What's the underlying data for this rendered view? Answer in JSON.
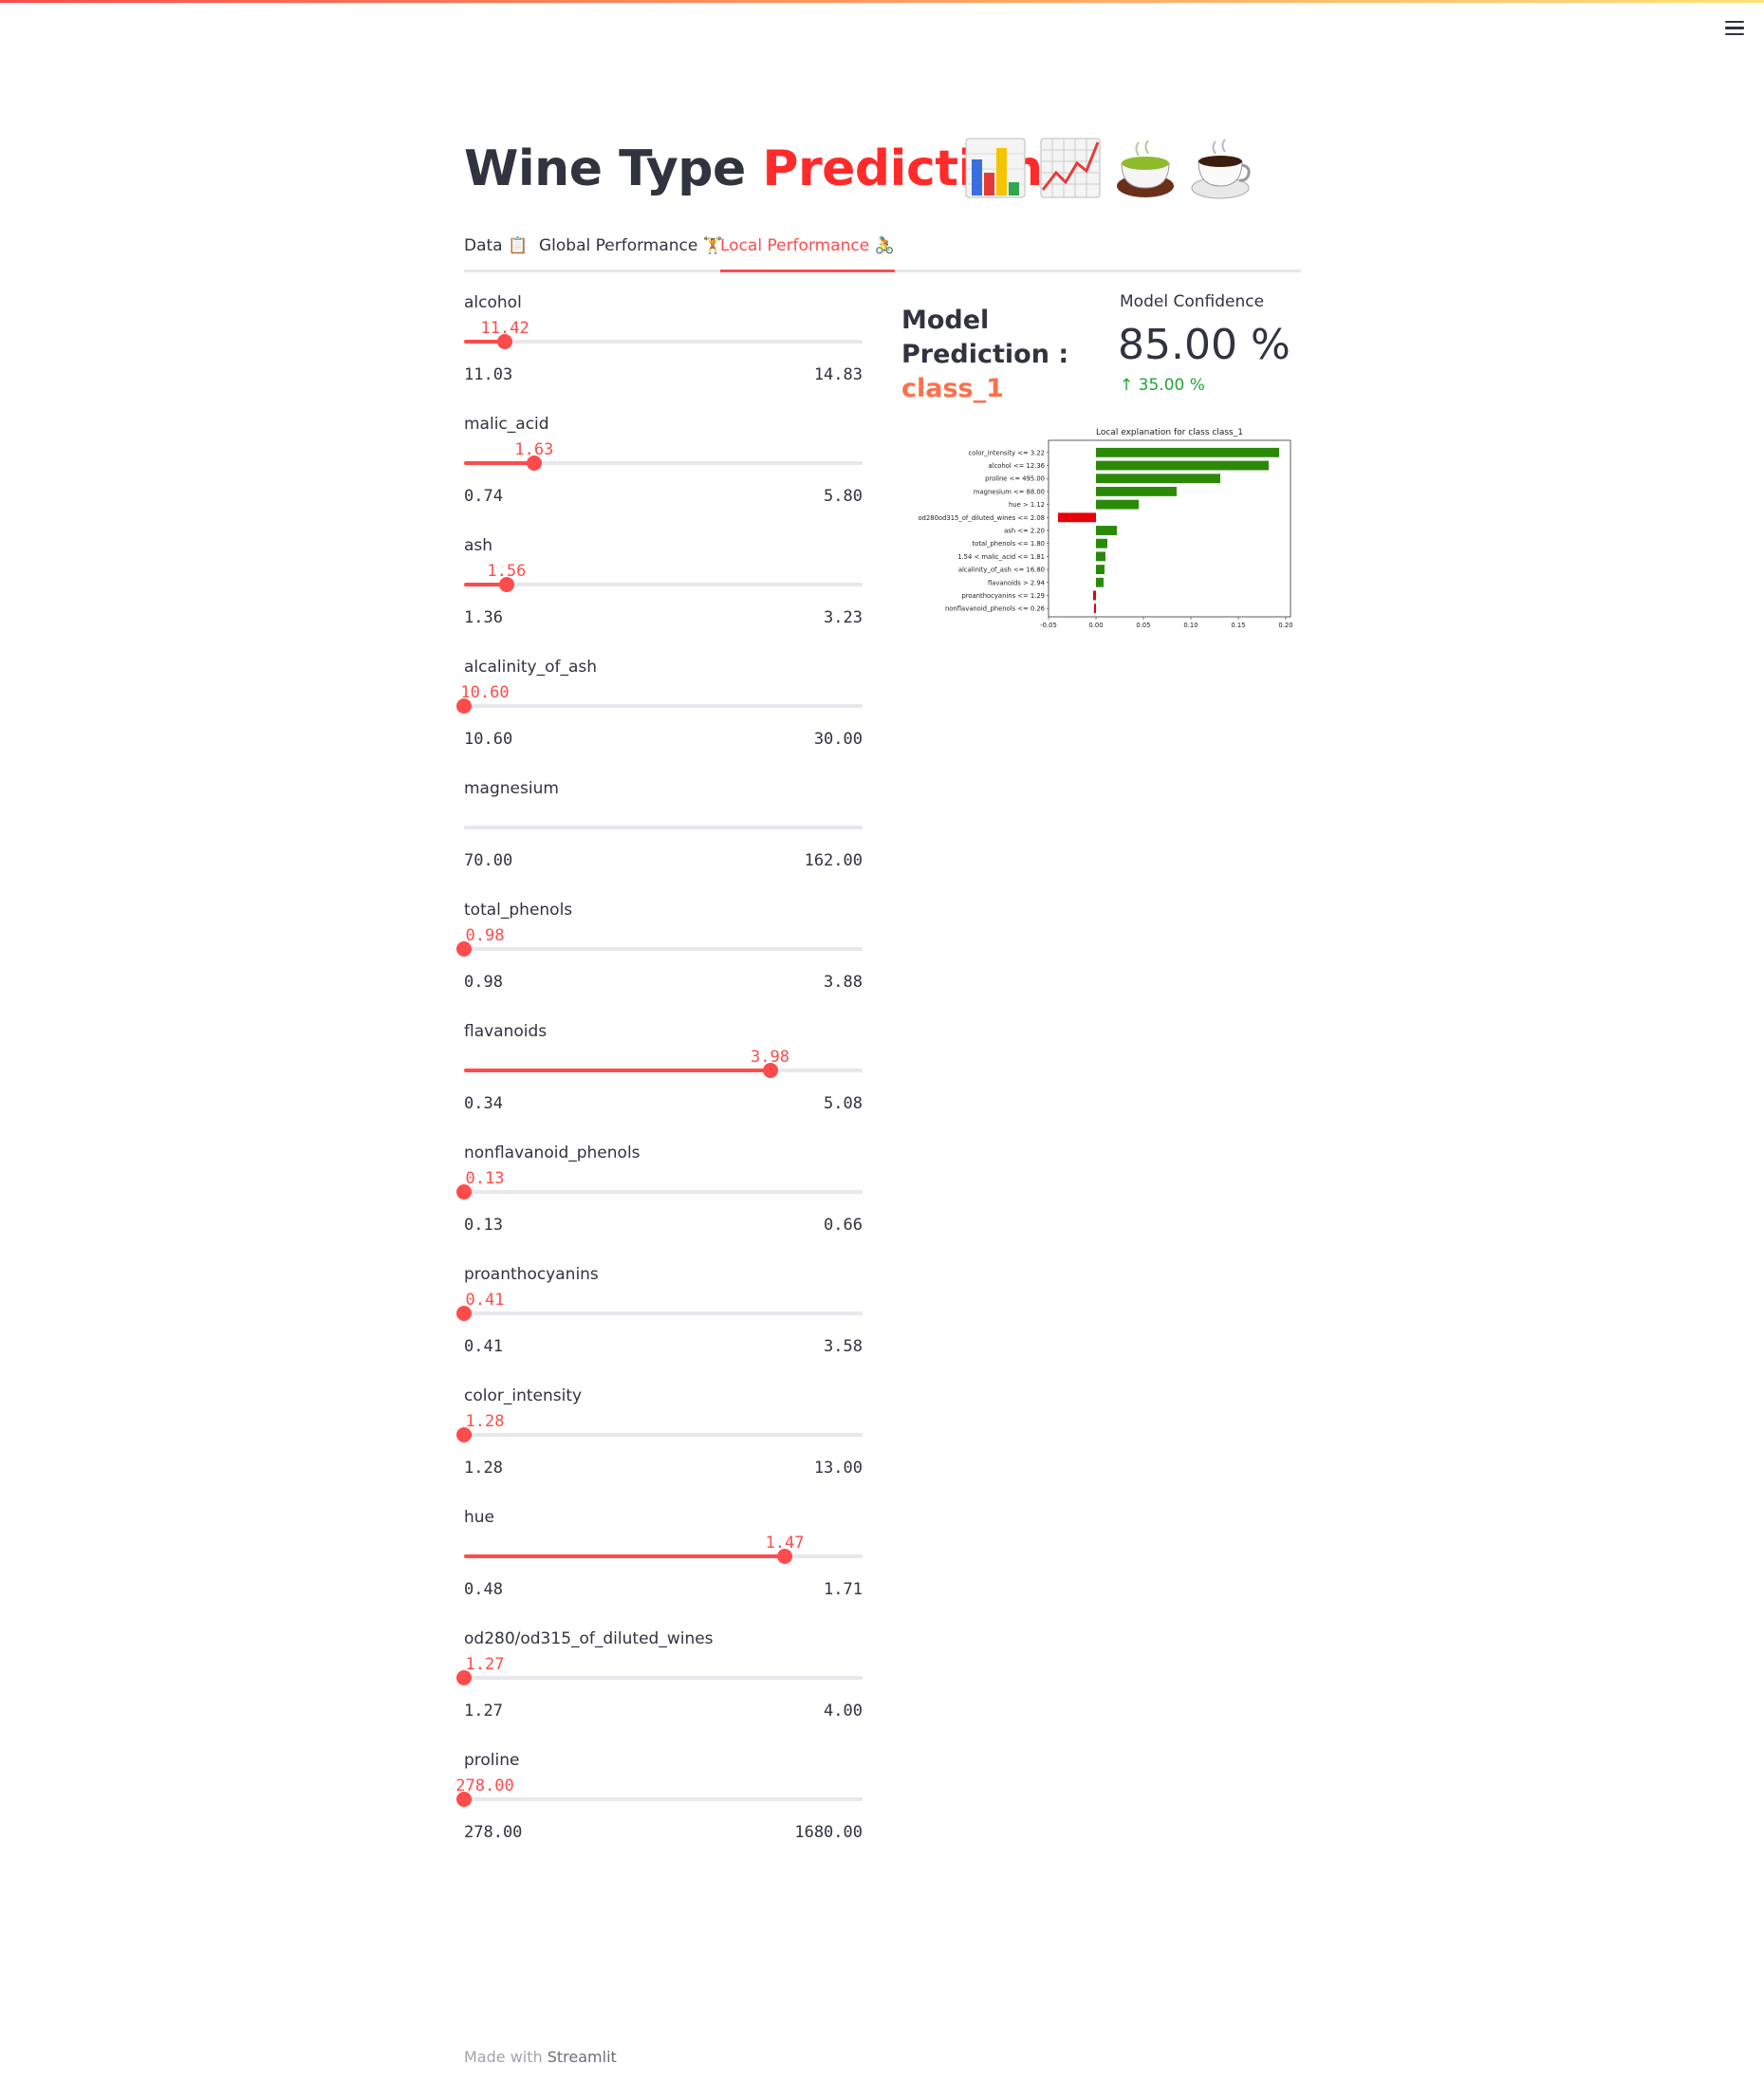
{
  "app": {
    "title_plain": "Wine Type",
    "title_accent": "Prediction",
    "title_emojis": [
      "bar-chart-icon",
      "line-chart-icon",
      "tea-icon",
      "coffee-icon"
    ]
  },
  "menu": {
    "icon": "hamburger-icon"
  },
  "tabs": [
    {
      "label": "Data",
      "icon": "clipboard-icon"
    },
    {
      "label": "Global Performance",
      "icon": "weightlifter-icon"
    },
    {
      "label": "Local Performance",
      "icon": "cyclist-icon",
      "active": true
    }
  ],
  "sliders": [
    {
      "label": "alcohol",
      "value": "11.42",
      "min": "11.03",
      "max": "14.83"
    },
    {
      "label": "malic_acid",
      "value": "1.63",
      "min": "0.74",
      "max": "5.80"
    },
    {
      "label": "ash",
      "value": "1.56",
      "min": "1.36",
      "max": "3.23"
    },
    {
      "label": "alcalinity_of_ash",
      "value": "10.60",
      "min": "10.60",
      "max": "30.00"
    },
    {
      "label": "magnesium",
      "value": "",
      "min": "70.00",
      "max": "162.00"
    },
    {
      "label": "total_phenols",
      "value": "0.98",
      "min": "0.98",
      "max": "3.88"
    },
    {
      "label": "flavanoids",
      "value": "3.98",
      "min": "0.34",
      "max": "5.08"
    },
    {
      "label": "nonflavanoid_phenols",
      "value": "0.13",
      "min": "0.13",
      "max": "0.66"
    },
    {
      "label": "proanthocyanins",
      "value": "0.41",
      "min": "0.41",
      "max": "3.58"
    },
    {
      "label": "color_intensity",
      "value": "1.28",
      "min": "1.28",
      "max": "13.00"
    },
    {
      "label": "hue",
      "value": "1.47",
      "min": "0.48",
      "max": "1.71"
    },
    {
      "label": "od280/od315_of_diluted_wines",
      "value": "1.27",
      "min": "1.27",
      "max": "4.00"
    },
    {
      "label": "proline",
      "value": "278.00",
      "min": "278.00",
      "max": "1680.00"
    }
  ],
  "prediction": {
    "line1": "Model",
    "line2": "Prediction :",
    "class": "class_1"
  },
  "metric": {
    "label": "Model Confidence",
    "value": "85.00 %",
    "delta": "35.00 %"
  },
  "chart_data": {
    "type": "bar",
    "orientation": "horizontal",
    "title": "Local explanation for class class_1",
    "categories": [
      "color_intensity <= 3.22",
      "alcohol <= 12.36",
      "proline <= 495.00",
      "magnesium <= 88.00",
      "hue > 1.12",
      "od280od315_of_diluted_wines <= 2.08",
      "ash <= 2.20",
      "total_phenols <= 1.80",
      "1.54 < malic_acid <= 1.81",
      "alcalinity_of_ash <= 16.80",
      "flavanoids > 2.94",
      "proanthocyanins <= 1.29",
      "nonflavanoid_phenols <= 0.26"
    ],
    "values": [
      0.193,
      0.182,
      0.131,
      0.085,
      0.045,
      -0.04,
      0.022,
      0.012,
      0.01,
      0.009,
      0.008,
      -0.003,
      -0.002
    ],
    "xticks": [
      "-0.05",
      "0.00",
      "0.05",
      "0.10",
      "0.15",
      "0.20"
    ],
    "xlim": [
      -0.05,
      0.205
    ],
    "colors": {
      "positive": "#2a8a08",
      "negative": "#e6000a"
    }
  },
  "footer": {
    "prefix": "Made with",
    "brand": "Streamlit"
  }
}
